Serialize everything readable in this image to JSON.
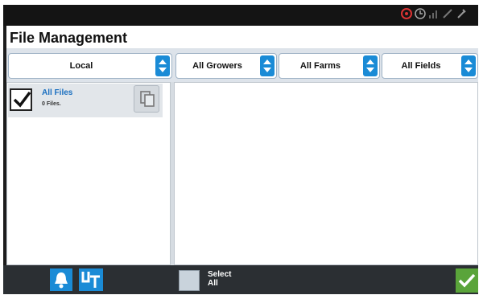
{
  "window": {
    "title": "File Management"
  },
  "status_bar": {
    "icons": [
      "gps-icon",
      "clock-icon",
      "signal-icon",
      "antenna-icon",
      "tool-icon"
    ]
  },
  "filters": {
    "source": "Local",
    "growers": "All Growers",
    "farms": "All Farms",
    "fields": "All Fields"
  },
  "file_list": {
    "items": [
      {
        "name": "All Files",
        "count": "0 Files.",
        "checked": true
      }
    ]
  },
  "bottom_bar": {
    "select_all_line1": "Select",
    "select_all_line2": "All",
    "accent": "#1a8bd6",
    "ok_color": "#5aa43a"
  }
}
